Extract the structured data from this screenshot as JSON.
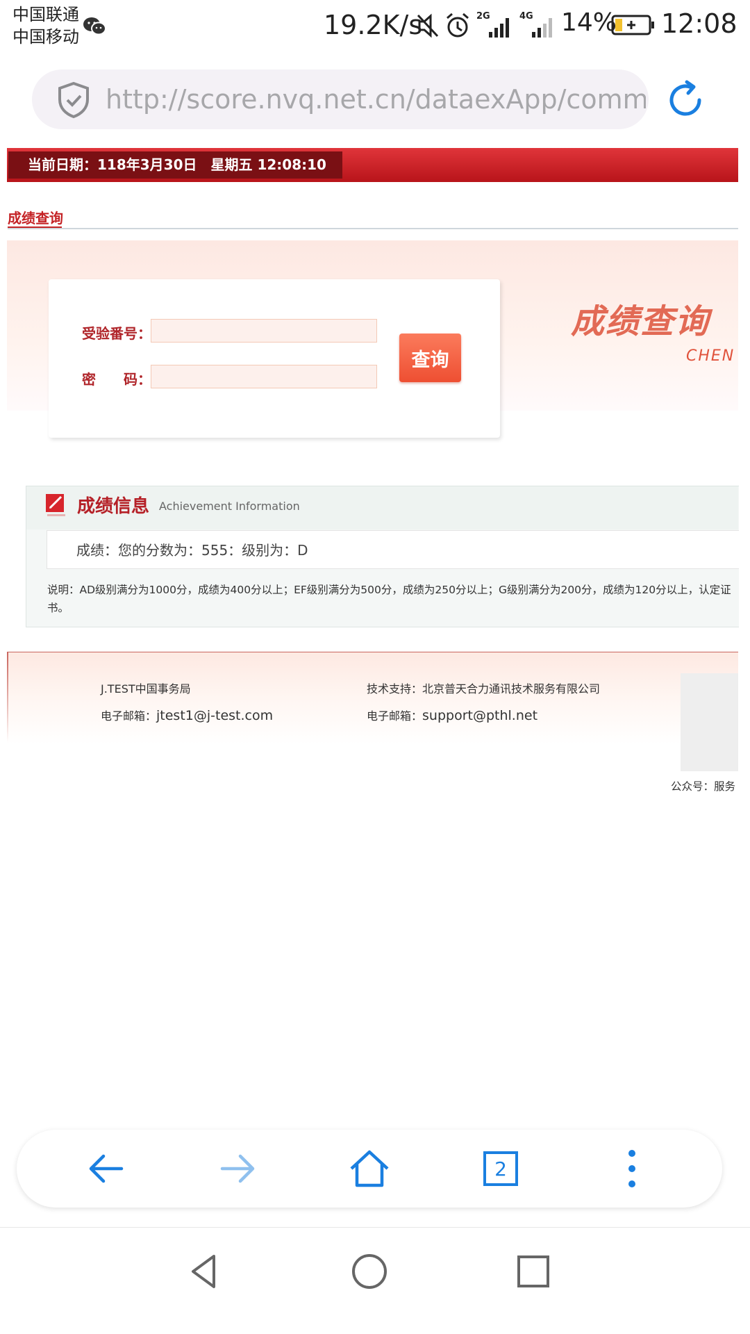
{
  "status_bar": {
    "carrier1": "中国联通",
    "carrier2": "中国移动",
    "speed": "19.2K/s",
    "network1": "2G",
    "network2": "4G",
    "battery": "14%",
    "time": "12:08",
    "icons": [
      "wechat-icon",
      "mute-icon",
      "alarm-icon",
      "signal-icon",
      "battery-icon"
    ]
  },
  "browser": {
    "url": "http://score.nvq.net.cn/dataexApp/comman...",
    "tab_count": "2",
    "colors": {
      "accent": "#1a7fe0"
    }
  },
  "page": {
    "date_label": "当前日期：118年3月30日　星期五 12:08:10",
    "tab_title": "成绩查询",
    "form": {
      "exam_no_label": "受验番号：",
      "password_label": "密　　码：",
      "exam_no_value": "",
      "password_value": "",
      "query_button": "查询"
    },
    "banner": {
      "title": "成绩查询",
      "subtitle": "CHEN"
    },
    "info": {
      "title": "成绩信息",
      "title_en": "Achievement  Information",
      "score_line": "成绩：您的分数为：555：级别为：D",
      "note": "说明：AD级别满分为1000分，成绩为400分以上；EF级别满分为500分，成绩为250分以上；G级别满分为200分，成绩为120分以上，认定证书。"
    },
    "footer": {
      "org": "J.TEST中国事务局",
      "support_label": "技术支持：",
      "support_value": "北京普天合力通讯技术服务有限公司",
      "email_label_1": "电子邮箱：",
      "email_1": "jtest1@j-test.com",
      "email_label_2": "电子邮箱：",
      "email_2": "support@pthl.net",
      "qr_caption": "公众号：服务"
    },
    "colors": {
      "brand_red": "#c42225",
      "button_orange": "#f05a3a"
    }
  }
}
